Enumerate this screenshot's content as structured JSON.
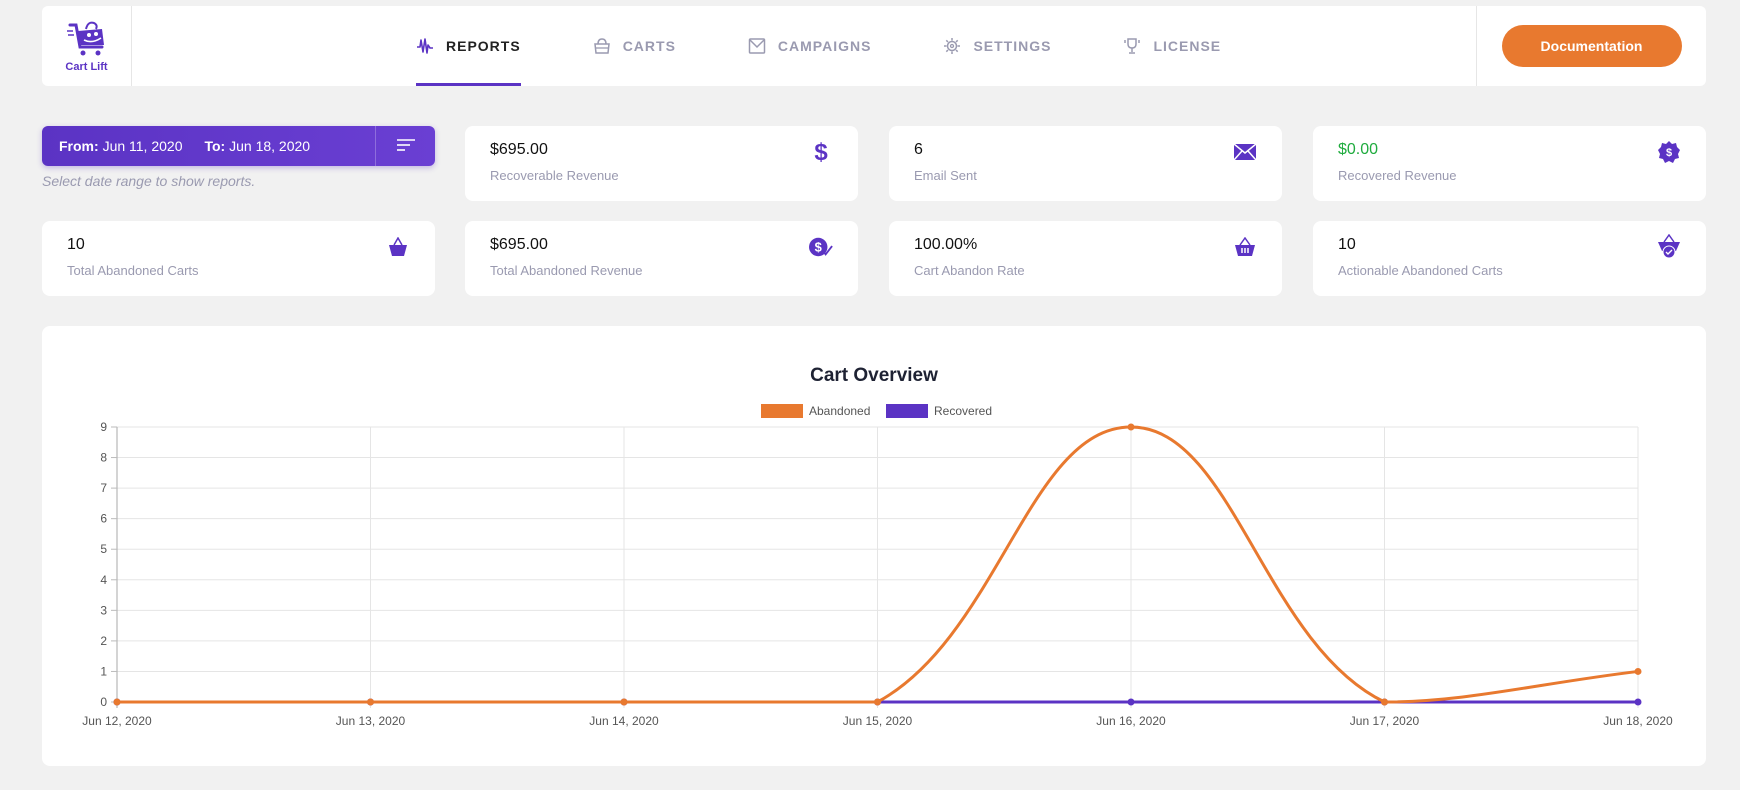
{
  "app": {
    "name": "Cart Lift"
  },
  "nav": {
    "items": [
      {
        "label": "REPORTS",
        "icon": "pulse-icon",
        "active": true
      },
      {
        "label": "CARTS",
        "icon": "basket-icon",
        "active": false
      },
      {
        "label": "CAMPAIGNS",
        "icon": "mail-icon",
        "active": false
      },
      {
        "label": "SETTINGS",
        "icon": "gear-icon",
        "active": false
      },
      {
        "label": "LICENSE",
        "icon": "trophy-icon",
        "active": false
      }
    ],
    "doc_button": "Documentation"
  },
  "date_filter": {
    "from_label": "From:",
    "from_value": "Jun 11, 2020",
    "to_label": "To:",
    "to_value": "Jun 18, 2020",
    "hint": "Select date range to show reports."
  },
  "stats": [
    {
      "value": "$695.00",
      "label": "Recoverable Revenue",
      "icon": "dollar-icon"
    },
    {
      "value": "6",
      "label": "Email Sent",
      "icon": "envelope-icon"
    },
    {
      "value": "$0.00",
      "label": "Recovered Revenue",
      "icon": "dollar-badge-icon",
      "color": "#1fab3e"
    },
    {
      "value": "10",
      "label": "Total Abandoned Carts",
      "icon": "basket-icon"
    },
    {
      "value": "$695.00",
      "label": "Total Abandoned Revenue",
      "icon": "dollar-check-icon"
    },
    {
      "value": "100.00%",
      "label": "Cart Abandon Rate",
      "icon": "basket-rate-icon"
    },
    {
      "value": "10",
      "label": "Actionable Abandoned Carts",
      "icon": "basket-check-icon"
    }
  ],
  "colors": {
    "accent": "#5b33c4",
    "orange": "#e8792f",
    "green": "#1fab3e"
  },
  "chart_data": {
    "type": "line",
    "title": "Cart Overview",
    "categories": [
      "Jun 12, 2020",
      "Jun 13, 2020",
      "Jun 14, 2020",
      "Jun 15, 2020",
      "Jun 16, 2020",
      "Jun 17, 2020",
      "Jun 18, 2020"
    ],
    "series": [
      {
        "name": "Abandoned",
        "color": "#e8792f",
        "values": [
          0,
          0,
          0,
          0,
          9,
          0,
          1
        ]
      },
      {
        "name": "Recovered",
        "color": "#5b33c4",
        "values": [
          0,
          0,
          0,
          0,
          0,
          0,
          0
        ]
      }
    ],
    "yticks": [
      0,
      1,
      2,
      3,
      4,
      5,
      6,
      7,
      8,
      9
    ],
    "ylim": [
      0,
      9
    ],
    "xlabel": "",
    "ylabel": "",
    "grid": true,
    "legend": "top-center"
  }
}
